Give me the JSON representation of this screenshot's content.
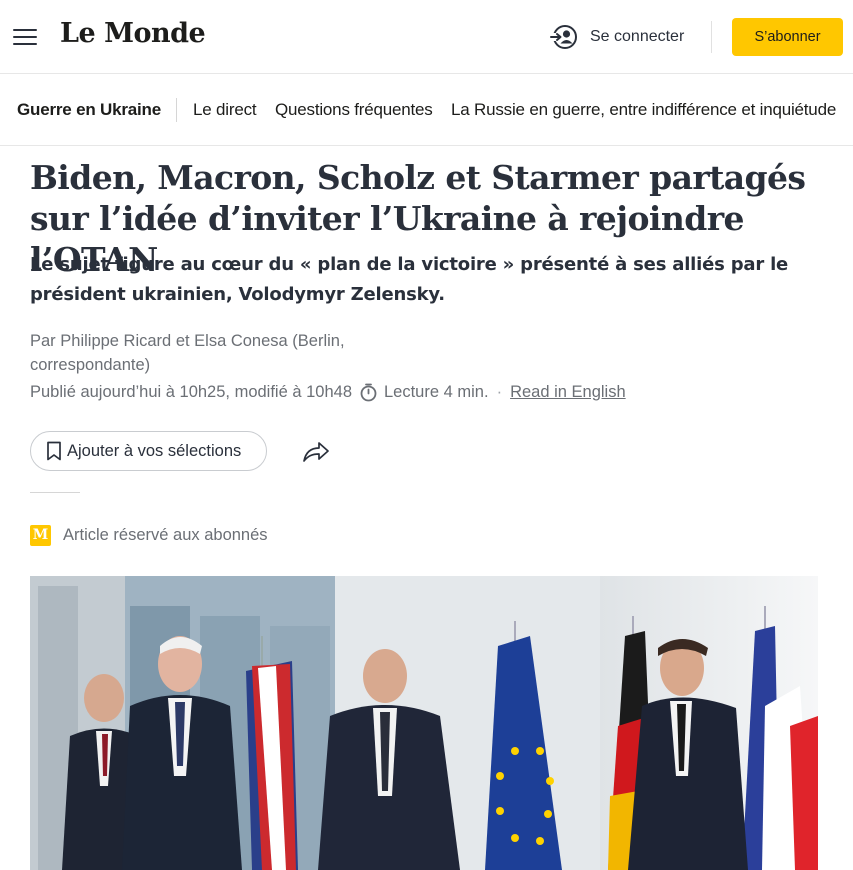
{
  "header": {
    "logo": "Le Monde",
    "login_label": "Se connecter",
    "subscribe_label": "S’abonner",
    "accent_color": "#ffc700"
  },
  "nav": {
    "section": "Guerre en Ukraine",
    "items": [
      {
        "label": "Le direct"
      },
      {
        "label": "Questions fréquentes"
      },
      {
        "label": "La Russie en guerre, entre indifférence et inquiétude"
      }
    ]
  },
  "article": {
    "headline": "Biden, Macron, Scholz et Starmer partagés sur l’idée d’inviter l’Ukraine à rejoindre l’OTAN",
    "subhead": "Le sujet figure au cœur du « plan de la victoire » présenté à ses alliés par le président ukrainien, Volodymyr Zelensky.",
    "byline": "Par Philippe Ricard et Elsa Conesa (Berlin, correspondante)",
    "published": "Publié aujourd’hui à 10h25, modifié à 10h48",
    "reading_time": "Lecture 4 min.",
    "read_in_english": "Read in English",
    "save_label": "Ajouter à vos sélections",
    "subscriber_note": "Article réservé aux abonnés",
    "subscriber_badge": "M"
  },
  "icons": [
    "menu-icon",
    "user-login-icon",
    "bookmark-icon",
    "share-icon",
    "clock-icon"
  ]
}
